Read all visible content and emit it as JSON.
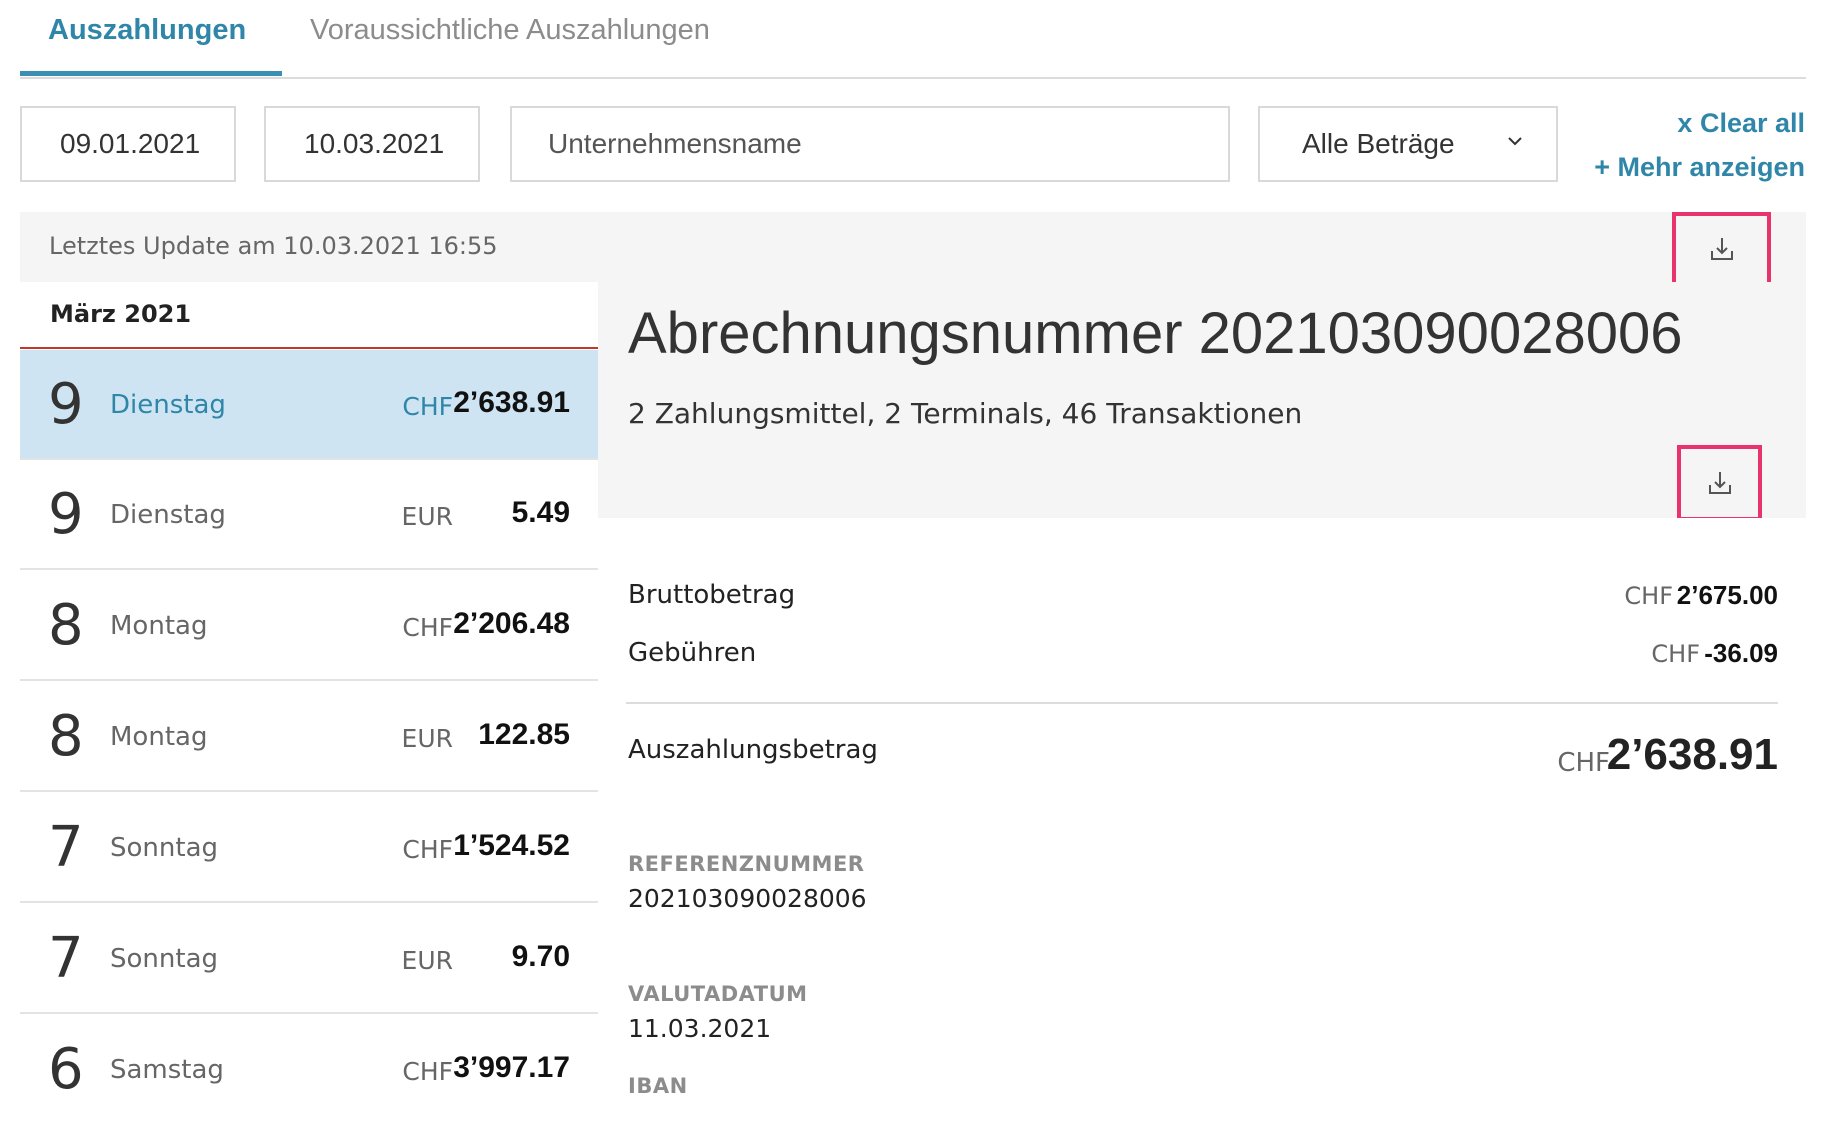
{
  "tabs": [
    {
      "label": "Auszahlungen"
    },
    {
      "label": "Voraussichtliche Auszahlungen"
    }
  ],
  "filters": {
    "date_from": "09.01.2021",
    "date_to": "10.03.2021",
    "company_placeholder": "Unternehmensname",
    "amount_select": "Alle Beträge",
    "clear_all": "x Clear all",
    "show_more": "+ Mehr anzeigen"
  },
  "last_update": "Letztes Update am 10.03.2021 16:55",
  "list": {
    "month": "März 2021",
    "items": [
      {
        "day": "9",
        "weekday": "Dienstag",
        "currency": "CHF",
        "amount": "2’638.91"
      },
      {
        "day": "9",
        "weekday": "Dienstag",
        "currency": "EUR",
        "amount": "5.49"
      },
      {
        "day": "8",
        "weekday": "Montag",
        "currency": "CHF",
        "amount": "2’206.48"
      },
      {
        "day": "8",
        "weekday": "Montag",
        "currency": "EUR",
        "amount": "122.85"
      },
      {
        "day": "7",
        "weekday": "Sonntag",
        "currency": "CHF",
        "amount": "1’524.52"
      },
      {
        "day": "7",
        "weekday": "Sonntag",
        "currency": "EUR",
        "amount": "9.70"
      },
      {
        "day": "6",
        "weekday": "Samstag",
        "currency": "CHF",
        "amount": "3’997.17"
      }
    ]
  },
  "detail": {
    "title": "Abrechnungsnummer 202103090028006",
    "subtitle": "2 Zahlungsmittel, 2 Terminals, 46 Transaktionen",
    "gross_label": "Bruttobetrag",
    "gross_currency": "CHF",
    "gross_amount": "2’675.00",
    "fees_label": "Gebühren",
    "fees_currency": "CHF",
    "fees_amount": "-36.09",
    "payout_label": "Auszahlungsbetrag",
    "payout_currency": "CHF",
    "payout_amount": "2’638.91",
    "reference_caption": "REFERENZNUMMER",
    "reference_value": "202103090028006",
    "value_date_caption": "VALUTADATUM",
    "value_date": "11.03.2021",
    "iban_caption": "IBAN"
  },
  "icons": {
    "download": "download-icon",
    "chevron": "chevron-down-icon"
  },
  "colors": {
    "accent": "#2f86a8",
    "selected_row": "#cfe4f3",
    "highlight_box": "#e8336d",
    "month_underline": "#c0392b"
  }
}
